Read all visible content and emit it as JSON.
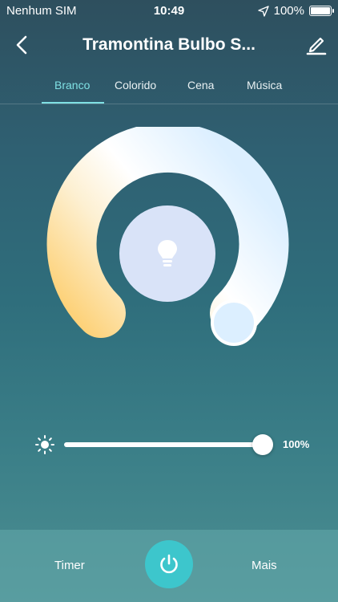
{
  "status_bar": {
    "carrier": "Nenhum SIM",
    "time": "10:49",
    "battery": "100%",
    "location_icon": "location-arrow-icon",
    "battery_icon": "battery-full-icon"
  },
  "header": {
    "title": "Tramontina Bulbo S...",
    "back_icon": "chevron-left-icon",
    "edit_icon": "pencil-icon"
  },
  "tabs": [
    {
      "label": "Branco",
      "active": true
    },
    {
      "label": "Colorido",
      "active": false
    },
    {
      "label": "Cena",
      "active": false
    },
    {
      "label": "Música",
      "active": false
    }
  ],
  "dial": {
    "center_icon": "lightbulb-icon",
    "colors": {
      "warm": "#fdd27a",
      "cool": "#dcefff",
      "center": "#d9e3f8"
    }
  },
  "brightness": {
    "icon": "sun-icon",
    "value": "100%",
    "level": 1.0
  },
  "bottom_bar": {
    "timer_label": "Timer",
    "more_label": "Mais",
    "power_icon": "power-icon",
    "power_color": "#3dc6cc"
  },
  "colors": {
    "accent": "#7fe0e4"
  }
}
